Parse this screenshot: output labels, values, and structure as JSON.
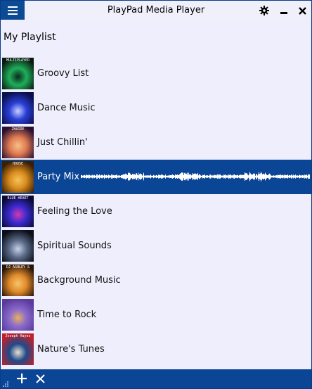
{
  "window": {
    "title": "PlayPad Media Player"
  },
  "titlebar_icons": {
    "menu": "hamburger-icon",
    "settings": "gear-icon",
    "minimize": "minimize-icon",
    "close": "close-icon"
  },
  "playlist": {
    "title": "My Playlist",
    "items": [
      {
        "label": "Groovy List",
        "thumb_text": "MULTIPLAYER RADIO",
        "colors": [
          "#0a1a10",
          "#1fae59",
          "#0a2a20"
        ],
        "active": false
      },
      {
        "label": "Dance Music",
        "thumb_text": "",
        "colors": [
          "#0a0f4a",
          "#2a3fd8",
          "#c7d0ff"
        ],
        "active": false
      },
      {
        "label": "Just Chillin'",
        "thumb_text": "ZHAIRE",
        "colors": [
          "#2a1030",
          "#e07a52",
          "#f5c089"
        ],
        "active": false
      },
      {
        "label": "Party Mix",
        "thumb_text": "HOUSE",
        "colors": [
          "#3a1e06",
          "#d98b1c",
          "#f4c35a"
        ],
        "active": true
      },
      {
        "label": "Feeling the Love",
        "thumb_text": "BLUE HEART",
        "colors": [
          "#0a0a35",
          "#3a2ad0",
          "#d03ab0"
        ],
        "active": false
      },
      {
        "label": "Spiritual Sounds",
        "thumb_text": "",
        "colors": [
          "#0a0e18",
          "#5a6a88",
          "#c8d2e8"
        ],
        "active": false
      },
      {
        "label": "Background Music",
        "thumb_text": "DJ ASHLEY & MASTER",
        "colors": [
          "#2a1608",
          "#e08a2a",
          "#f6c46a"
        ],
        "active": false
      },
      {
        "label": "Time to Rock",
        "thumb_text": "",
        "colors": [
          "#5a3a9a",
          "#8a6acc",
          "#e8b060"
        ],
        "active": false
      },
      {
        "label": "Nature's Tunes",
        "thumb_text": "Joseph Hayes",
        "colors": [
          "#c0202a",
          "#1e4a8a",
          "#e8e0d0"
        ],
        "active": false
      }
    ]
  },
  "footer": {
    "add_icon": "plus-icon",
    "remove_icon": "x-icon",
    "accent": "#0b4596"
  }
}
